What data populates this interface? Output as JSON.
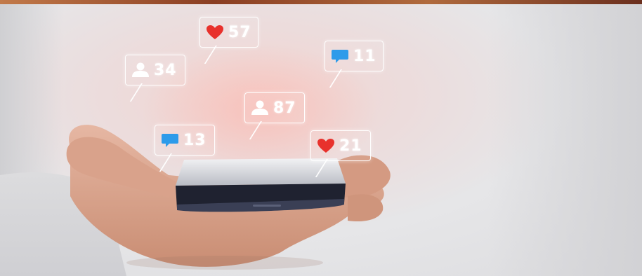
{
  "notifications": [
    {
      "type": "like",
      "icon": "heart-icon",
      "count": "57",
      "color": "#e8312c"
    },
    {
      "type": "follower",
      "icon": "user-icon",
      "count": "34",
      "color": "#ffffff"
    },
    {
      "type": "comment",
      "icon": "comment-icon",
      "count": "11",
      "color": "#2d9bea"
    },
    {
      "type": "follower",
      "icon": "user-icon",
      "count": "87",
      "color": "#ffffff"
    },
    {
      "type": "comment",
      "icon": "comment-icon",
      "count": "13",
      "color": "#2d9bea"
    },
    {
      "type": "like",
      "icon": "heart-icon",
      "count": "21",
      "color": "#e8312c"
    }
  ]
}
